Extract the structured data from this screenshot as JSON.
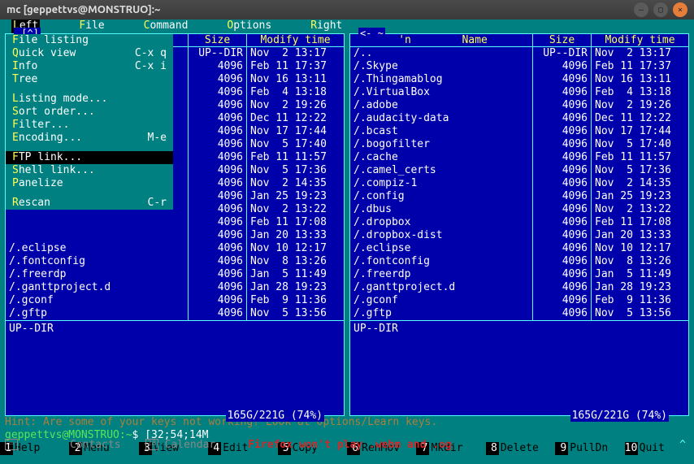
{
  "title": "mc [geppettvs@MONSTRUO]:~",
  "menubar": [
    "Left",
    "File",
    "Command",
    "Options",
    "Right"
  ],
  "dropdown": [
    {
      "h": "F",
      "t": "ile listing",
      "sc": ""
    },
    {
      "h": "Q",
      "t": "uick view",
      "sc": "C-x q"
    },
    {
      "h": "I",
      "t": "nfo",
      "sc": "C-x i"
    },
    {
      "h": "T",
      "t": "ree",
      "sc": ""
    },
    null,
    {
      "h": "L",
      "t": "isting mode...",
      "sc": ""
    },
    {
      "h": "S",
      "t": "ort order...",
      "sc": ""
    },
    {
      "h": "F",
      "t": "ilter...",
      "sc": ""
    },
    {
      "h": "E",
      "t": "ncoding...",
      "sc": "M-e"
    },
    null,
    {
      "h": "F",
      "t": "TP link...",
      "sc": "",
      "sel": true
    },
    {
      "h": "S",
      "t": "hell link...",
      "sc": ""
    },
    {
      "h": "P",
      "t": "anelize",
      "sc": ""
    },
    null,
    {
      "h": "R",
      "t": "escan",
      "sc": "C-r"
    }
  ],
  "left": {
    "path": ".[^]",
    "updir": "UP--DIR",
    "disk": "165G/221G (74%)",
    "header": {
      "n": "",
      "s": "Size",
      "m": "Modify time",
      "npfx": ""
    },
    "rows": [
      {
        "n": "",
        "s": "UP--DIR",
        "m": "Nov  2 13:17"
      },
      {
        "n": "",
        "s": "4096",
        "m": "Feb 11 17:37"
      },
      {
        "n": "",
        "s": "4096",
        "m": "Nov 16 13:11"
      },
      {
        "n": "",
        "s": "4096",
        "m": "Feb  4 13:18"
      },
      {
        "n": "",
        "s": "4096",
        "m": "Nov  2 19:26"
      },
      {
        "n": "",
        "s": "4096",
        "m": "Dec 11 12:22"
      },
      {
        "n": "",
        "s": "4096",
        "m": "Nov 17 17:44"
      },
      {
        "n": "",
        "s": "4096",
        "m": "Nov  5 17:40"
      },
      {
        "n": "",
        "s": "4096",
        "m": "Feb 11 11:57"
      },
      {
        "n": "",
        "s": "4096",
        "m": "Nov  5 17:36"
      },
      {
        "n": "",
        "s": "4096",
        "m": "Nov  2 14:35"
      },
      {
        "n": "",
        "s": "4096",
        "m": "Jan 25 19:23"
      },
      {
        "n": "",
        "s": "4096",
        "m": "Nov  2 13:22"
      },
      {
        "n": "",
        "s": "4096",
        "m": "Feb 11 17:08"
      },
      {
        "n": "",
        "s": "4096",
        "m": "Jan 20 13:33"
      },
      {
        "n": "/.eclipse",
        "s": "4096",
        "m": "Nov 10 12:17"
      },
      {
        "n": "/.fontconfig",
        "s": "4096",
        "m": "Nov  8 13:26"
      },
      {
        "n": "/.freerdp",
        "s": "4096",
        "m": "Jan  5 11:49"
      },
      {
        "n": "/.ganttproject.d",
        "s": "4096",
        "m": "Jan 28 19:23"
      },
      {
        "n": "/.gconf",
        "s": "4096",
        "m": "Feb  9 11:36"
      },
      {
        "n": "/.gftp",
        "s": "4096",
        "m": "Nov  5 13:56"
      }
    ]
  },
  "right": {
    "path": "<- ~",
    "updir": "UP--DIR",
    "disk": "165G/221G (74%)",
    "header": {
      "n": "Name",
      "s": "Size",
      "m": "Modify time",
      "npfx": "'n"
    },
    "rows": [
      {
        "n": "/..",
        "s": "UP--DIR",
        "m": "Nov  2 13:17"
      },
      {
        "n": "/.Skype",
        "s": "4096",
        "m": "Feb 11 17:37"
      },
      {
        "n": "/.Thingamablog",
        "s": "4096",
        "m": "Nov 16 13:11"
      },
      {
        "n": "/.VirtualBox",
        "s": "4096",
        "m": "Feb  4 13:18"
      },
      {
        "n": "/.adobe",
        "s": "4096",
        "m": "Nov  2 19:26"
      },
      {
        "n": "/.audacity-data",
        "s": "4096",
        "m": "Dec 11 12:22"
      },
      {
        "n": "/.bcast",
        "s": "4096",
        "m": "Nov 17 17:44"
      },
      {
        "n": "/.bogofilter",
        "s": "4096",
        "m": "Nov  5 17:40"
      },
      {
        "n": "/.cache",
        "s": "4096",
        "m": "Feb 11 11:57"
      },
      {
        "n": "/.camel_certs",
        "s": "4096",
        "m": "Nov  5 17:36"
      },
      {
        "n": "/.compiz-1",
        "s": "4096",
        "m": "Nov  2 14:35"
      },
      {
        "n": "/.config",
        "s": "4096",
        "m": "Jan 25 19:23"
      },
      {
        "n": "/.dbus",
        "s": "4096",
        "m": "Nov  2 13:22"
      },
      {
        "n": "/.dropbox",
        "s": "4096",
        "m": "Feb 11 17:08"
      },
      {
        "n": "/.dropbox-dist",
        "s": "4096",
        "m": "Jan 20 13:33"
      },
      {
        "n": "/.eclipse",
        "s": "4096",
        "m": "Nov 10 12:17"
      },
      {
        "n": "/.fontconfig",
        "s": "4096",
        "m": "Nov  8 13:26"
      },
      {
        "n": "/.freerdp",
        "s": "4096",
        "m": "Jan  5 11:49"
      },
      {
        "n": "/.ganttproject.d",
        "s": "4096",
        "m": "Jan 28 19:23"
      },
      {
        "n": "/.gconf",
        "s": "4096",
        "m": "Feb  9 11:36"
      },
      {
        "n": "/.gftp",
        "s": "4096",
        "m": "Nov  5 13:56"
      }
    ]
  },
  "hint": "Hint: Are some of your keys not working? Look at Options/Learn keys.",
  "prompt": {
    "user": "geppettvs@MONSTRUO:~",
    "rest": "$ [32;54;14M"
  },
  "task": {
    "contacts": "Contacts",
    "calendar": "Calendar",
    "day": "28",
    "ff": "Firefox won't play .webm and .og"
  },
  "fkeys": [
    {
      "n": "1",
      "l": "Help"
    },
    {
      "n": "2",
      "l": "Menu"
    },
    {
      "n": "3",
      "l": "View"
    },
    {
      "n": "4",
      "l": "Edit"
    },
    {
      "n": "5",
      "l": "Copy"
    },
    {
      "n": "6",
      "l": "RenMov"
    },
    {
      "n": "7",
      "l": "Mkdir"
    },
    {
      "n": "8",
      "l": "Delete"
    },
    {
      "n": "9",
      "l": "PullDn"
    },
    {
      "n": "10",
      "l": "Quit"
    }
  ]
}
